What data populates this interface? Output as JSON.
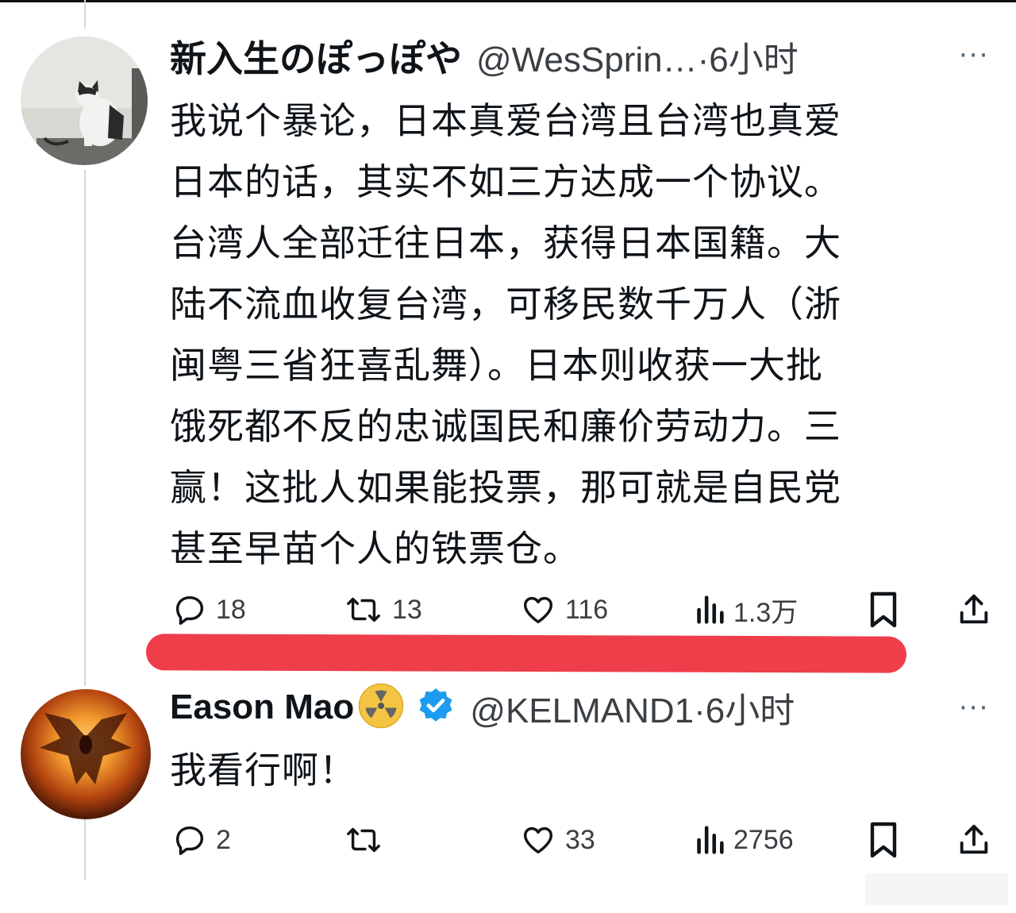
{
  "tweet1": {
    "display_name": "新入生のぽっぽや",
    "handle_time": "@WesSprin…·6小时",
    "more": "···",
    "text_lines": [
      "我说个暴论，日本真爱台湾且台湾也真爱",
      "日本的话，其实不如三方达成一个协议。",
      "台湾人全部迁往日本，获得日本国籍。大",
      "陆不流血收复台湾，可移民数千万人（浙",
      "闽粤三省狂喜乱舞）。日本则收获一大批",
      "饿死都不反的忠诚国民和廉价劳动力。三",
      "赢！这批人如果能投票，那可就是自民党",
      "甚至早苗个人的铁票仓。"
    ],
    "actions": {
      "reply": "18",
      "retweet": "13",
      "like": "116",
      "views": "1.3万"
    }
  },
  "tweet2": {
    "display_name": "Eason Mao",
    "handle_time": "@KELMAND1·6小时",
    "more": "···",
    "text": "我看行啊！",
    "actions": {
      "reply": "2",
      "retweet": "",
      "like": "33",
      "views": "2756"
    }
  },
  "colors": {
    "text": "#0f1419",
    "secondary": "#536471",
    "thread_line": "#cfd9de",
    "underline_mark": "#ee3e4a",
    "verified": "#1d9bf0",
    "badge": "#f4c542"
  },
  "icons": [
    "reply-icon",
    "retweet-icon",
    "like-icon",
    "views-icon",
    "bookmark-icon",
    "share-icon",
    "verified-icon",
    "radioactive-icon",
    "more-icon"
  ]
}
